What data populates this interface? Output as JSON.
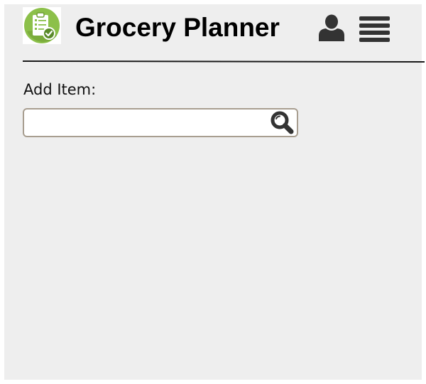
{
  "header": {
    "title": "Grocery Planner",
    "logo_icon": "clipboard-check-icon",
    "user_icon": "user-icon",
    "menu_icon": "hamburger-menu-icon"
  },
  "main": {
    "add_item_label": "Add Item:",
    "search": {
      "value": "",
      "placeholder": "",
      "icon": "magnifier-icon"
    }
  },
  "colors": {
    "background": "#eeeeee",
    "logo_green": "#8cc04a",
    "icon_dark": "#333333",
    "input_border": "#a89e90"
  }
}
